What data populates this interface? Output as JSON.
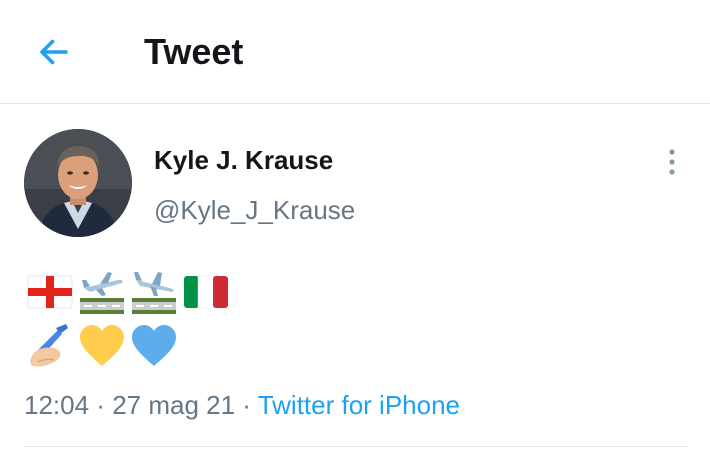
{
  "header": {
    "title": "Tweet",
    "back_icon": "arrow-left-icon"
  },
  "tweet": {
    "author_name": "Kyle J. Krause",
    "author_handle": "@Kyle_J_Krause",
    "emojis_line1": [
      "flag-england",
      "airplane-on-runway",
      "airplane-on-runway",
      "flag-italy"
    ],
    "emojis_line2": [
      "writing-hand",
      "yellow-heart",
      "blue-heart"
    ],
    "time": "12:04",
    "separator": " · ",
    "date": "27 mag 21",
    "source": "Twitter for iPhone"
  },
  "colors": {
    "accent": "#1da1f2",
    "secondary_text": "#657786",
    "divider": "#e1e8ed"
  }
}
